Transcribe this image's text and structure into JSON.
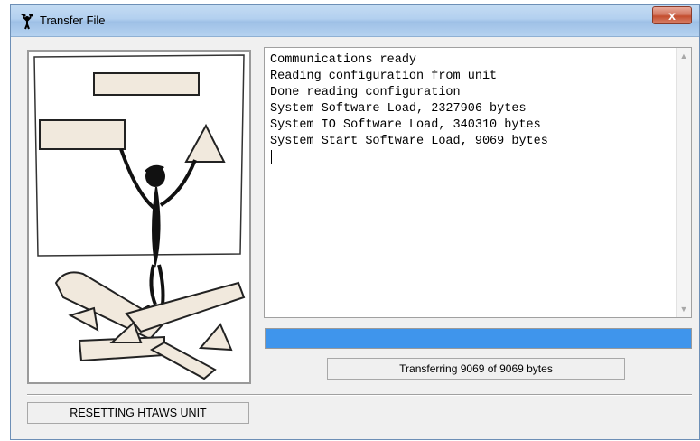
{
  "window": {
    "title": "Transfer File",
    "close_label": "x"
  },
  "log": {
    "lines": [
      "Communications ready",
      "Reading configuration from unit",
      "Done reading configuration",
      "System Software Load, 2327906 bytes",
      "System IO Software Load, 340310 bytes",
      "System Start Software Load, 9069 bytes"
    ]
  },
  "progress": {
    "fraction": 1.0,
    "fill_color": "#3f95ec"
  },
  "transfer": {
    "status_text": "Transferring 9069 of 9069 bytes"
  },
  "status": {
    "text": "RESETTING HTAWS UNIT"
  },
  "icons": {
    "app": "stick-figure-icon",
    "illustration": "stick-figure-with-boards-illustration"
  }
}
